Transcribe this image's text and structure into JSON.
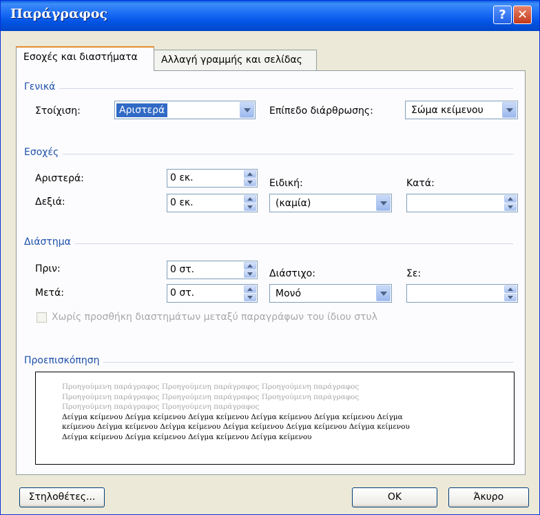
{
  "window": {
    "title": "Παράγραφος",
    "help": "?",
    "close": "✕"
  },
  "tabs": [
    {
      "label": "Εσοχές και διαστήματα"
    },
    {
      "label": "Αλλαγή γραμμής και σελίδας"
    }
  ],
  "general": {
    "title": "Γενικά",
    "alignment_label": "Στοίχιση:",
    "alignment_value": "Αριστερά",
    "outline_label": "Επίπεδο διάρθρωσης:",
    "outline_value": "Σώμα κείμενου"
  },
  "indentation": {
    "title": "Εσοχές",
    "left_label": "Αριστερά:",
    "left_value": "0 εκ.",
    "right_label": "Δεξιά:",
    "right_value": "0 εκ.",
    "special_label": "Ειδική:",
    "special_value": "(καμία)",
    "by_label": "Κατά:",
    "by_value": ""
  },
  "spacing": {
    "title": "Διάστημα",
    "before_label": "Πριν:",
    "before_value": "0 στ.",
    "after_label": "Μετά:",
    "after_value": "0 στ.",
    "line_label": "Διάστιχο:",
    "line_value": "Μονό",
    "at_label": "Σε:",
    "at_value": "",
    "no_space_checkbox": "Χωρίς προσθήκη διαστημάτων μεταξύ παραγράφων του ίδιου στυλ"
  },
  "preview": {
    "title": "Προεπισκόπηση",
    "gray_lines": [
      "Προηγούμενη παράγραφος Προηγούμενη παράγραφος Προηγούμενη παράγραφος",
      "Προηγούμενη παράγραφος Προηγούμενη παράγραφος Προηγούμενη παράγραφος",
      "Προηγούμενη παράγραφος Προηγούμενη παράγραφος"
    ],
    "black_lines": [
      "Δείγμα κείμενου Δείγμα κείμενου Δείγμα κείμενου Δείγμα κείμενου Δείγμα κείμενου Δείγμα",
      "κείμενου Δείγμα κείμενου Δείγμα κείμενου Δείγμα κείμενου Δείγμα κείμενου Δείγμα κείμενου",
      "Δείγμα κείμενου Δείγμα κείμενου Δείγμα κείμενου Δείγμα κείμενου"
    ]
  },
  "buttons": {
    "tabs": "Στηλοθέτες...",
    "ok": "OK",
    "cancel": "Άκυρο"
  }
}
